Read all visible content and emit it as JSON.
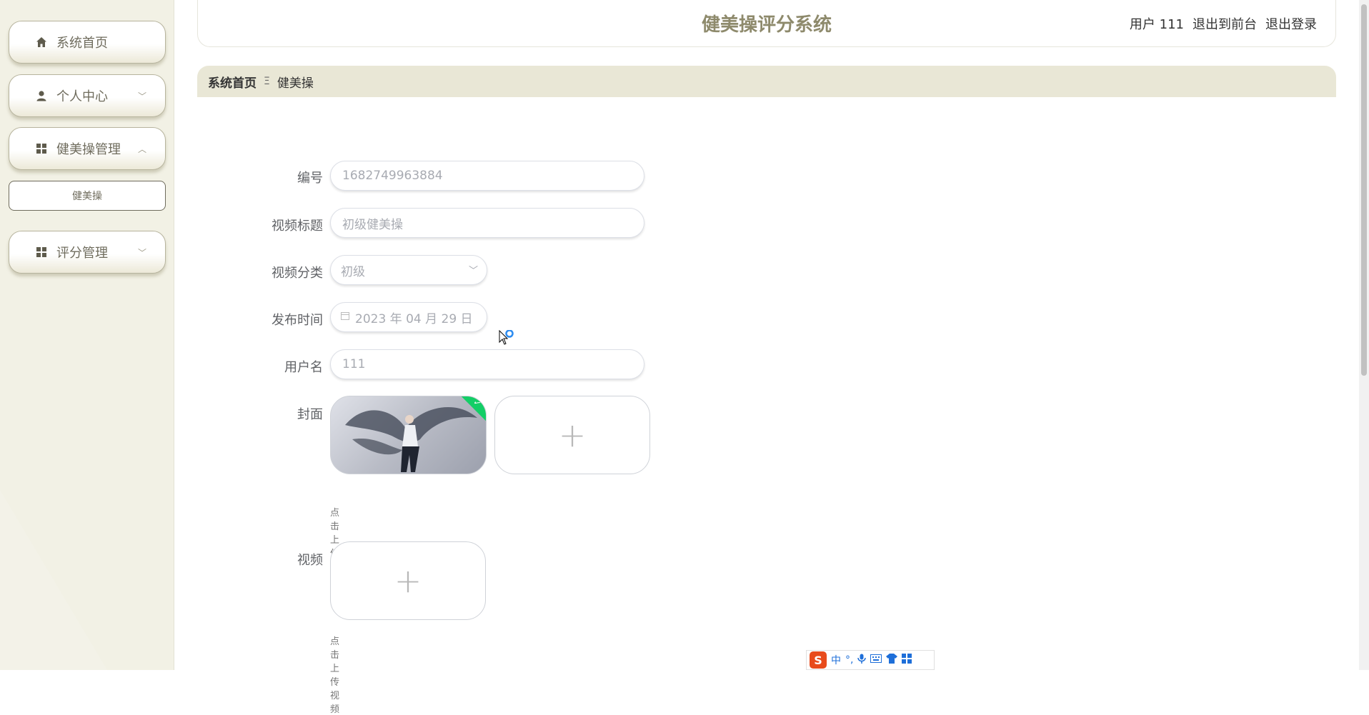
{
  "sidebar": {
    "items": [
      {
        "label": "系统首页",
        "icon": "home-icon"
      },
      {
        "label": "个人中心",
        "icon": "user-icon",
        "expanded": false
      },
      {
        "label": "健美操管理",
        "icon": "grid-icon",
        "expanded": true,
        "children": [
          {
            "label": "健美操"
          }
        ]
      },
      {
        "label": "评分管理",
        "icon": "grid-icon",
        "expanded": false
      }
    ]
  },
  "header": {
    "title": "健美操评分系统",
    "user": "用户 111",
    "to_front": "退出到前台",
    "logout": "退出登录"
  },
  "breadcrumb": {
    "home": "系统首页",
    "sep": "Ξ",
    "current": "健美操"
  },
  "form": {
    "id_label": "编号",
    "id_value": "1682749963884",
    "title_label": "视频标题",
    "title_value": "初级健美操",
    "category_label": "视频分类",
    "category_value": "初级",
    "date_label": "发布时间",
    "date_value": "2023 年 04 月 29 日",
    "username_label": "用户名",
    "username_value": "111",
    "cover_label": "封面",
    "cover_hint": "点击上传封面",
    "video_label": "视频",
    "video_hint": "点击上传视频"
  },
  "ime": {
    "label": "中"
  },
  "colors": {
    "accent": "#8e8a6c",
    "sidebar_bg": "#f2f1e5",
    "breadcrumb_bg": "#e9e7d6",
    "success": "#13ce66"
  }
}
